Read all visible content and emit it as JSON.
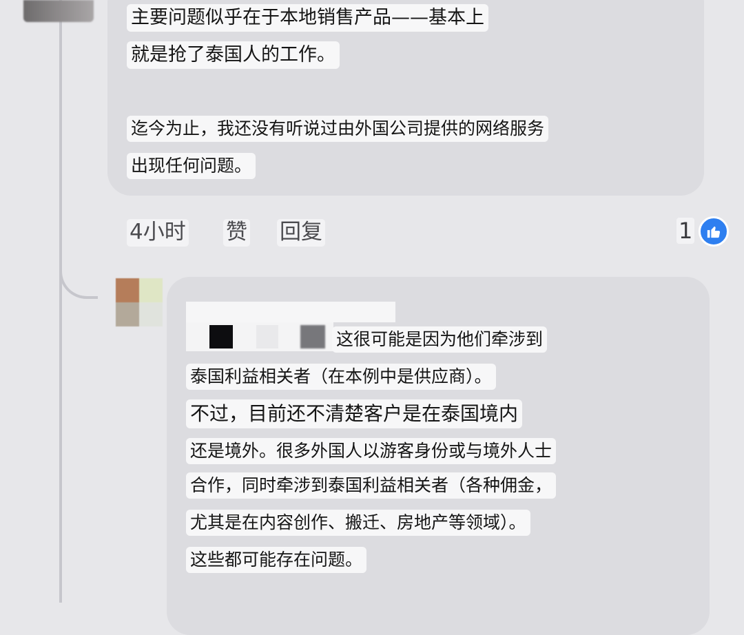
{
  "comment": {
    "paragraph1": [
      "主要问题似乎在于本地销售产品——基本上",
      "就是抢了泰国人的工作。"
    ],
    "paragraph2": [
      "迄今为止，我还没有听说过由外国公司提供的网络服务",
      "出现任何问题。"
    ],
    "actions": {
      "time": "4小时",
      "like": "赞",
      "reply": "回复"
    },
    "like_count": "1"
  },
  "reply": {
    "lines": [
      "这很可能是因为他们牵涉到",
      "泰国利益相关者（在本例中是供应商）。",
      "不过，目前还不清楚客户是在泰国境内",
      "还是境外。很多外国人以游客身份或与境外人士",
      "合作，同时牵涉到泰国利益相关者（各种佣金，",
      "尤其是在内容创作、搬迁、房地产等领域）。",
      "这些都可能存在问题。"
    ]
  },
  "colors": {
    "background": "#e7e7ea",
    "bubble": "#dcdce0",
    "text_highlight": "#f7f7f8",
    "like_blue": "#2e7ff0"
  },
  "icons": {
    "like": "thumbs-up-icon"
  }
}
